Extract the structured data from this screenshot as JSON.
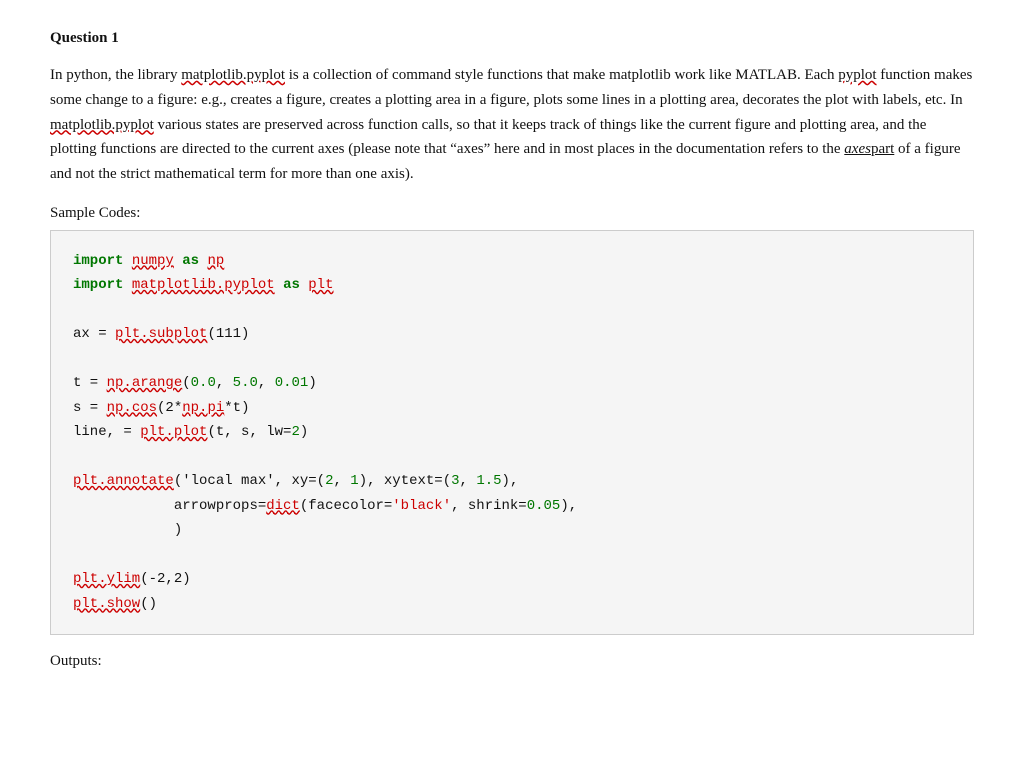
{
  "question": {
    "title": "Question 1",
    "paragraph1": "In python, the library matplotlib.pyplot is a collection of command style functions that make matplotlib work like MATLAB. Each pyplot function makes some change to a figure: e.g., creates a figure, creates a plotting area in a figure, plots some lines in a plotting area, decorates the plot with labels, etc. In matplotlib.pyplot various states are preserved across function calls, so that it keeps track of things like the current figure and plotting area, and the plotting functions are directed to the current axes (please note that “axes” here and in most places in the documentation refers to the axespart of a figure and not the strict mathematical term for more than one axis).",
    "sample_codes_label": "Sample Codes:",
    "outputs_label": "Outputs:"
  }
}
